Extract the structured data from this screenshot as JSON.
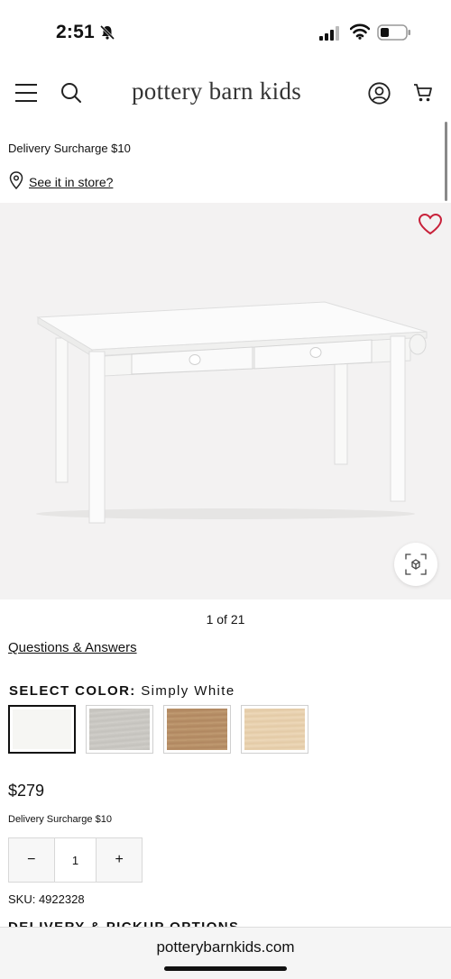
{
  "status_bar": {
    "time": "2:51"
  },
  "header": {
    "brand": "pottery barn kids",
    "icons": [
      "menu-icon",
      "search-icon",
      "account-icon",
      "cart-icon"
    ]
  },
  "product": {
    "top_surcharge": "Delivery Surcharge $10",
    "store_link": "See it in store?",
    "image_counter": "1 of 21",
    "qa_link": "Questions & Answers",
    "color_label": "SELECT COLOR:",
    "selected_color": "Simply White",
    "swatches": [
      {
        "color": "#f6f6f3",
        "selected": true
      },
      {
        "color": "#c9c7c2",
        "selected": false
      },
      {
        "color": "#b8926a",
        "selected": false
      },
      {
        "color": "#e9d3b3",
        "selected": false
      }
    ],
    "price": "$279",
    "bottom_surcharge": "Delivery Surcharge $10",
    "quantity": {
      "minus": "−",
      "value": "1",
      "plus": "+"
    },
    "sku": "SKU: 4922328",
    "delivery_heading": "DELIVERY & PICKUP OPTIONS"
  },
  "browser": {
    "url": "potterybarnkids.com"
  },
  "colors": {
    "wishlist": "#c8213a",
    "image_bg": "#f3f2f2"
  }
}
